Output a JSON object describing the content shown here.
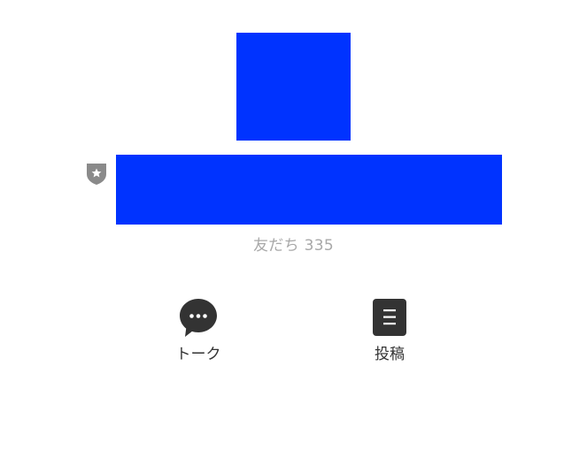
{
  "colors": {
    "redaction": "#0033ff",
    "badge": "#8a8a8a",
    "icon": "#333333",
    "muted_text": "#a8a8a8"
  },
  "profile": {
    "avatar_icon": "redacted-avatar",
    "badge_icon": "shield-star-icon",
    "name_icon": "redacted-name",
    "friends_label": "友だち",
    "friends_count": "335"
  },
  "actions": [
    {
      "icon": "speech-bubble-icon",
      "label": "トーク"
    },
    {
      "icon": "document-icon",
      "label": "投稿"
    }
  ]
}
